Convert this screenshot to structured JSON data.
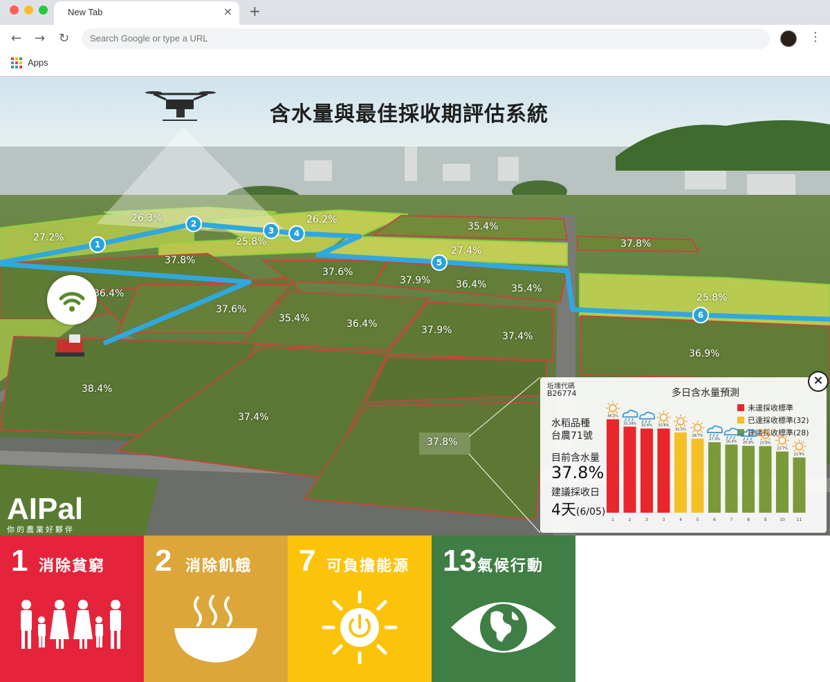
{
  "browser": {
    "tab_title": "New Tab",
    "tab_close": "×",
    "new_tab": "+",
    "omnibox_placeholder": "Search Google or type a URL",
    "bookmarks": [
      {
        "label": "Apps",
        "icon": "apps-grid-icon"
      }
    ],
    "colors": {
      "traffic_red": "#ff5f57",
      "traffic_yellow": "#febc2e",
      "traffic_green": "#28c840"
    }
  },
  "hero": {
    "title": "含水量與最佳採收期評估系統",
    "field_moisture": [
      "26.3%",
      "26.2%",
      "27.2%",
      "25.8%",
      "35.4%",
      "37.8%",
      "27.4%",
      "37.8%",
      "36.4%",
      "37.6%",
      "37.9%",
      "36.4%",
      "35.4%",
      "25.8%",
      "37.6%",
      "35.4%",
      "36.4%",
      "37.9%",
      "37.4%",
      "36.9%",
      "38.4%",
      "37.4%",
      "37.8%"
    ],
    "waypoints": [
      "1",
      "2",
      "3",
      "4",
      "5",
      "6"
    ],
    "logo": "AIPal",
    "logo_sub": "你的農業好夥伴",
    "route_color": "#2fa8e0"
  },
  "panel": {
    "code_label": "坵塊代碼",
    "code": "B26774",
    "title": "多日含水量預測",
    "variety_label": "水稻品種",
    "variety": "台農71號",
    "moisture_label": "目前含水量",
    "moisture": "37.8%",
    "harvest_label": "建議採收日",
    "harvest_days": "4天",
    "harvest_date": "(6/05)",
    "close": "×"
  },
  "chart_data": {
    "type": "bar",
    "title": "多日含水量預測",
    "categories": [
      "1",
      "2",
      "3",
      "3",
      "4",
      "5",
      "6",
      "7",
      "8",
      "9",
      "10",
      "11"
    ],
    "values": [
      36.2,
      33.34,
      32.6,
      32.6,
      31.1,
      28.7,
      27.3,
      26.4,
      25.9,
      25.8,
      23.7,
      21.4
    ],
    "value_labels": [
      "36.2%",
      "33.34%",
      "32.6%",
      "32.6%",
      "31.1%",
      "28.7%",
      "27.3%",
      "26.4%",
      "25.9%",
      "25.8%",
      "23.7%",
      "21.4%"
    ],
    "colors": [
      "#e8262b",
      "#e8262b",
      "#e8262b",
      "#e8262b",
      "#f4c025",
      "#f4c025",
      "#7a9a3a",
      "#7a9a3a",
      "#7a9a3a",
      "#7a9a3a",
      "#7a9a3a",
      "#7a9a3a"
    ],
    "weather_icons": [
      "sun-icon",
      "rain-icon",
      "rain-icon",
      "sun-icon",
      "sun-icon",
      "sun-icon",
      "rain-icon",
      "rain-icon",
      "rain-icon",
      "sun-icon",
      "sun-icon",
      "sun-icon"
    ],
    "legend": [
      {
        "label": "未達採收標準",
        "color": "#e8262b"
      },
      {
        "label": "已達採收標準(32)",
        "color": "#f4c025"
      },
      {
        "label": "建議採收標準(28)",
        "color": "#7a9a3a"
      }
    ],
    "ylim": [
      0,
      38
    ],
    "legend_position": "top-right",
    "grid": false
  },
  "sdgs": [
    {
      "number": "1",
      "label": "消除貧窮",
      "color": "#e5243b",
      "icon": "family-icon"
    },
    {
      "number": "2",
      "label": "消除飢餓",
      "color": "#dda63a",
      "icon": "bowl-icon"
    },
    {
      "number": "7",
      "label": "可負擔能源",
      "color": "#fcc30b",
      "icon": "sun-power-icon"
    },
    {
      "number": "13",
      "label": "氣候行動",
      "color": "#3f7e44",
      "icon": "eye-globe-icon"
    }
  ]
}
